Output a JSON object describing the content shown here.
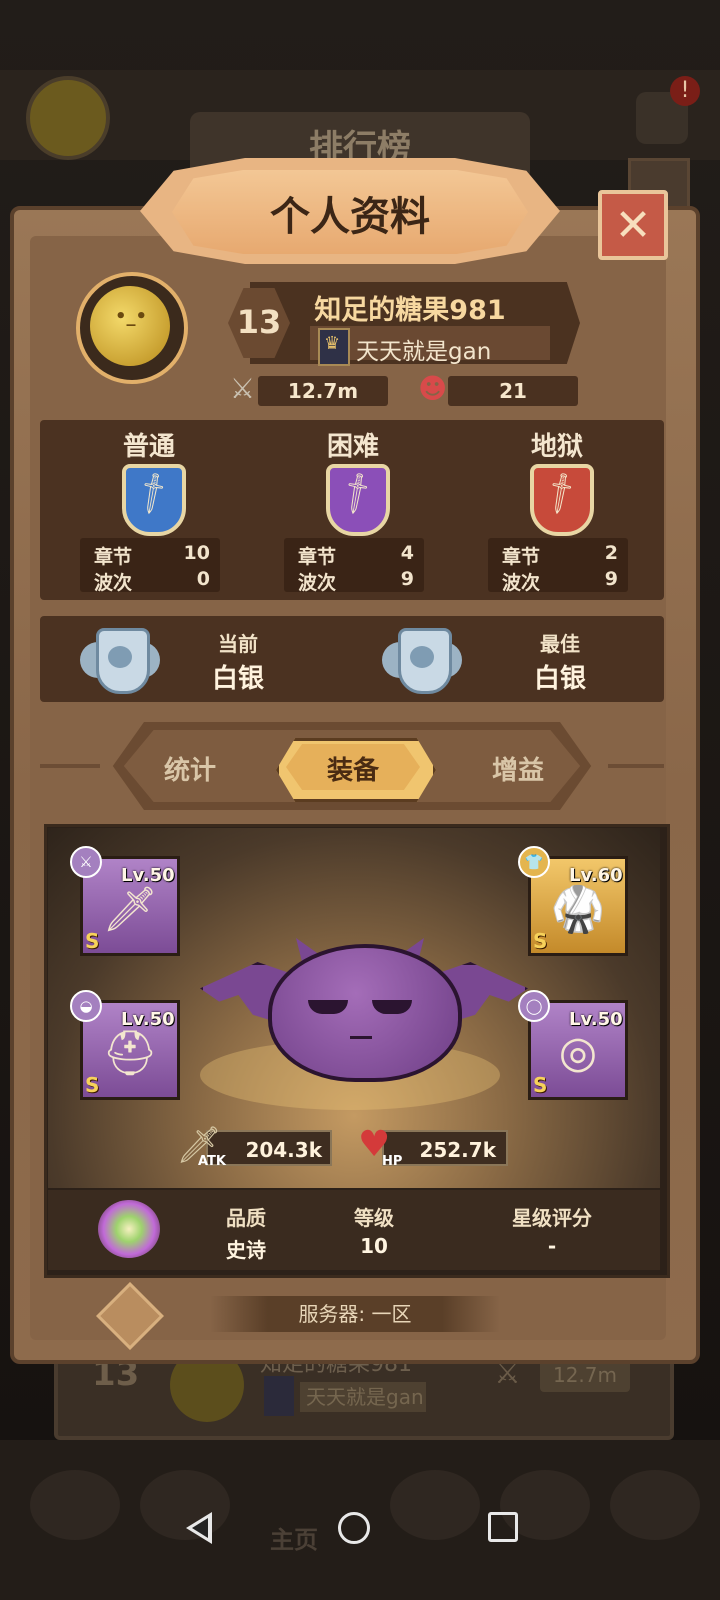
{
  "background": {
    "ranking_title": "排行榜",
    "notification_dot": "!",
    "row": {
      "rank": "13",
      "name": "知足的糖果981",
      "guild": "天天就是gan",
      "power": "12.7m"
    },
    "home_label": "主页"
  },
  "profile": {
    "title": "个人资料",
    "close_icon": "close-icon",
    "avatar_icon": "yellow-slime-icon",
    "level": "13",
    "player_name": "知足的糖果981",
    "guild_name": "天天就是gan",
    "combat_power": "12.7m",
    "kills": "21"
  },
  "modes": [
    {
      "title": "普通",
      "chapter_label": "章节",
      "chapter": "10",
      "wave_label": "波次",
      "wave": "0",
      "color": "#3f78c8"
    },
    {
      "title": "困难",
      "chapter_label": "章节",
      "chapter": "4",
      "wave_label": "波次",
      "wave": "9",
      "color": "#8b4fb8"
    },
    {
      "title": "地狱",
      "chapter_label": "章节",
      "chapter": "2",
      "wave_label": "波次",
      "wave": "9",
      "color": "#c74a3a"
    }
  ],
  "rank": {
    "current_label": "当前",
    "current_value": "白银",
    "best_label": "最佳",
    "best_value": "白银"
  },
  "tabs": [
    {
      "label": "统计",
      "active": false
    },
    {
      "label": "装备",
      "active": true
    },
    {
      "label": "增益",
      "active": false
    }
  ],
  "equipment": {
    "weapon": {
      "level": "Lv.50",
      "grade": "S",
      "icon": "blade-icon"
    },
    "armor": {
      "level": "Lv.60",
      "grade": "S",
      "icon": "robe-icon"
    },
    "helmet": {
      "level": "Lv.50",
      "grade": "S",
      "icon": "helmet-icon"
    },
    "ring": {
      "level": "Lv.50",
      "grade": "S",
      "icon": "ring-icon"
    },
    "atk_label": "ATK",
    "atk": "204.3k",
    "hp_label": "HP",
    "hp": "252.7k",
    "pet_icon": "purple-bat-slime-icon"
  },
  "info": {
    "quality_label": "品质",
    "quality": "史诗",
    "level_label": "等级",
    "level": "10",
    "star_label": "星级评分",
    "star": "-"
  },
  "server": "服务器: 一区"
}
